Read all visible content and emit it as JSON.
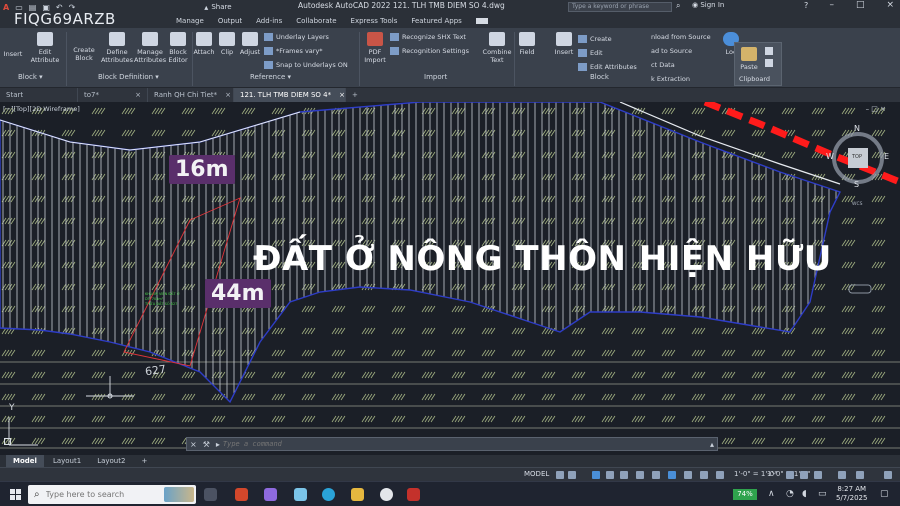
{
  "window": {
    "title": "Autodesk AutoCAD 2022   121. TLH TMB DIEM SO 4.dwg",
    "share": "Share",
    "search_placeholder": "Type a keyword or phrase",
    "sign_in": "Sign In",
    "help": "?"
  },
  "watermark": "FIQG69ARZB",
  "menu": [
    "Manage",
    "Output",
    "Add-ins",
    "Collaborate",
    "Express Tools",
    "Featured Apps"
  ],
  "ribbon": {
    "block": {
      "insert": "Insert",
      "edit_attribute": "Edit Attribute",
      "create_block": "Create Block",
      "define_attributes": "Define Attributes",
      "manage_attributes": "Manage Attributes",
      "block_editor": "Block Editor",
      "panel": "Block ▾",
      "panel2": "Block Definition ▾"
    },
    "reference": {
      "attach": "Attach",
      "clip": "Clip",
      "adjust": "Adjust",
      "underlay_layers": "Underlay Layers",
      "frames": "*Frames vary*",
      "snap": "Snap to Underlays ON",
      "panel": "Reference ▾"
    },
    "import": {
      "pdf": "PDF Import",
      "recognize_shx": "Recognize SHX Text",
      "recognition_settings": "Recognition Settings",
      "combine_text": "Combine Text",
      "panel": "Import"
    },
    "field": "Field",
    "block2": {
      "insert": "Insert",
      "create": "Create",
      "edit": "Edit",
      "edit_attributes": "Edit Attributes",
      "panel": "Block"
    },
    "data": {
      "download": "nload from Source",
      "upload": "ad to Source",
      "ct_data": "ct  Data",
      "extraction": "k Extraction"
    },
    "loc": "Loc",
    "clipboard": {
      "paste": "Paste",
      "panel": "Clipboard"
    }
  },
  "tabs": [
    "Start",
    "to7*",
    "Ranh QH Chi Tiet*",
    "121. TLH TMB DIEM SO 4*"
  ],
  "tab_close": "×",
  "tab_add": "+",
  "viewport": {
    "label": "[−][Top][2D Wireframe]",
    "controls": "–  □  ×"
  },
  "viewcube": {
    "n": "N",
    "s": "S",
    "e": "E",
    "w": "W",
    "top": "TOP",
    "wcs": "WCS"
  },
  "dims": {
    "width": "16m",
    "length": "44m"
  },
  "main_label": "ĐẤT Ở NÔNG THÔN HIỆN HỮU",
  "parcel_number": "627",
  "y_axis": "Y",
  "command": {
    "placeholder": "Type a command"
  },
  "layouts": [
    "Model",
    "Layout1",
    "Layout2"
  ],
  "layout_add": "+",
  "status": {
    "model": "MODEL",
    "scale1": "1'-0\" = 1'-0\"",
    "scale2": "1'-0\" = 1'-0\""
  },
  "taskbar": {
    "search_placeholder": "Type here to search",
    "battery": "74%",
    "time": "8:27 AM",
    "date": "5/7/2025"
  }
}
